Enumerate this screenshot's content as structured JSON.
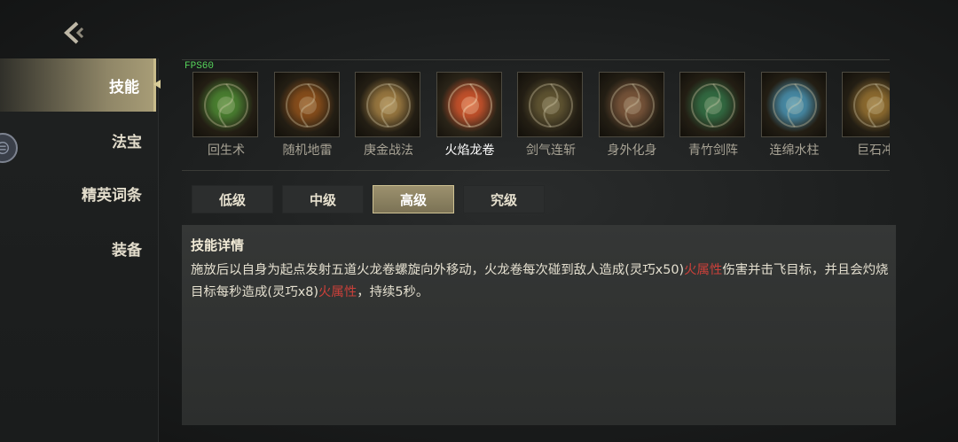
{
  "fps": "FPS60",
  "sidebar": {
    "items": [
      {
        "label": "技能",
        "active": true
      },
      {
        "label": "法宝",
        "active": false
      },
      {
        "label": "精英词条",
        "active": false
      },
      {
        "label": "装备",
        "active": false
      }
    ]
  },
  "skills": [
    {
      "name": "回生术",
      "icon": "healing-swirl-icon",
      "color": "#5fa63c"
    },
    {
      "name": "随机地雷",
      "icon": "landmine-orb-icon",
      "color": "#b0621e"
    },
    {
      "name": "庚金战法",
      "icon": "golden-swirl-icon",
      "color": "#c79a4f"
    },
    {
      "name": "火焰龙卷",
      "icon": "fire-tornado-icon",
      "color": "#d9562a"
    },
    {
      "name": "剑气连斩",
      "icon": "sword-slash-icon",
      "color": "#7a6a3c"
    },
    {
      "name": "身外化身",
      "icon": "clone-figure-icon",
      "color": "#9a6a46"
    },
    {
      "name": "青竹剑阵",
      "icon": "bamboo-sword-icon",
      "color": "#3f8a52"
    },
    {
      "name": "连绵水柱",
      "icon": "water-pillar-icon",
      "color": "#5bb4d8"
    },
    {
      "name": "巨石冲",
      "icon": "boulder-icon",
      "color": "#b88a3a"
    }
  ],
  "active_skill_index": 3,
  "tiers": [
    {
      "label": "低级",
      "active": false
    },
    {
      "label": "中级",
      "active": false
    },
    {
      "label": "高级",
      "active": true
    },
    {
      "label": "究级",
      "active": false
    }
  ],
  "detail": {
    "title": "技能详情",
    "segments": [
      {
        "text": "施放后以自身为起点发射五道火龙卷螺旋向外移动，火龙卷每次碰到敌人造成(灵巧x50)",
        "style": "normal"
      },
      {
        "text": "火属性",
        "style": "fire"
      },
      {
        "text": "伤害并击飞目标，并且会灼烧目标每秒造成(灵巧x8)",
        "style": "normal"
      },
      {
        "text": "火属性",
        "style": "fire"
      },
      {
        "text": "，持续5秒。",
        "style": "normal"
      }
    ]
  },
  "colors": {
    "accent_gold": "#a79c76",
    "fire_text": "#c9403a",
    "fps_green": "#56d45b"
  }
}
